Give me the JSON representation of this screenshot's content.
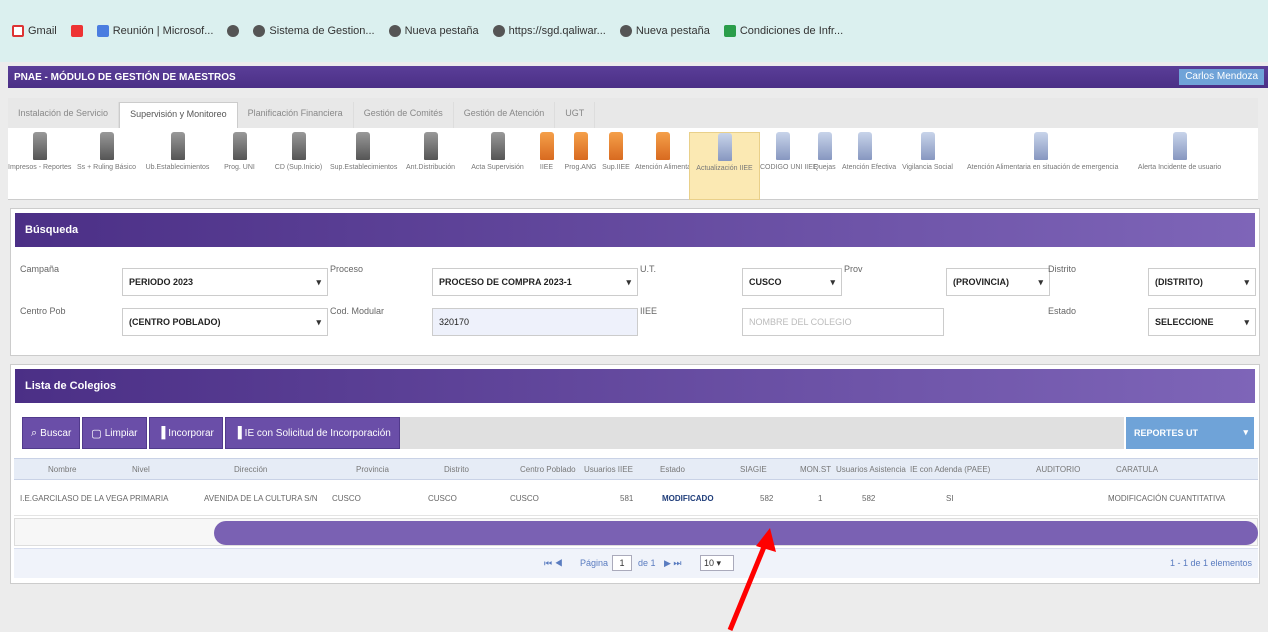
{
  "bookmarks": [
    {
      "label": "Gmail",
      "icon": "gmail-icon"
    },
    {
      "label": "",
      "icon": "red-app-icon"
    },
    {
      "label": "Reunión | Microsof...",
      "icon": "microsoft-icon"
    },
    {
      "label": "",
      "icon": "globe-icon"
    },
    {
      "label": "Sistema de Gestion...",
      "icon": "globe-icon"
    },
    {
      "label": "Nueva pestaña",
      "icon": "globe-icon"
    },
    {
      "label": "https://sgd.qaliwar...",
      "icon": "globe-icon"
    },
    {
      "label": "Nueva pestaña",
      "icon": "globe-icon"
    },
    {
      "label": "Condiciones de Infr...",
      "icon": "sheets-icon"
    }
  ],
  "app": {
    "title": "PNAE - MÓDULO DE GESTIÓN DE MAESTROS",
    "user": "Carlos Mendoza"
  },
  "tabs": [
    "Instalación de Servicio",
    "Supervisión y Monitoreo",
    "Planificación Financiera",
    "Gestión de Comités",
    "Gestión de Atención",
    "UGT"
  ],
  "active_tab": 1,
  "tools": [
    {
      "label": "Impresos - Reportes",
      "color": "gray"
    },
    {
      "label": "Ss + Ruling Básico",
      "color": "gray"
    },
    {
      "label": "Ub.Establecimientos",
      "color": "gray"
    },
    {
      "label": "Prog. UNI",
      "color": "gray"
    },
    {
      "label": "CD (Sup.Inicio)",
      "color": "gray"
    },
    {
      "label": "Sup.Establecimientos",
      "color": "gray"
    },
    {
      "label": "Ant.Distribución",
      "color": "gray"
    },
    {
      "label": "Acta Supervisión",
      "color": "gray"
    },
    {
      "label": "IIEE",
      "color": "orange"
    },
    {
      "label": "Prog.ANG",
      "color": "orange"
    },
    {
      "label": "Sup.IIEE",
      "color": "orange"
    },
    {
      "label": "Atención Alimentaria",
      "color": "orange"
    },
    {
      "label": "Actualización IIEE",
      "color": "blue"
    },
    {
      "label": "CODIGO UNI IIEE",
      "color": "blue"
    },
    {
      "label": "Quejas",
      "color": "blue"
    },
    {
      "label": "Atención Efectiva",
      "color": "blue"
    },
    {
      "label": "Vigilancia Social",
      "color": "blue"
    },
    {
      "label": "Atención Alimentaria en situación de emergencia",
      "color": "blue"
    },
    {
      "label": "Alerta Incidente de usuario",
      "color": "blue"
    }
  ],
  "selected_tool": 12,
  "search": {
    "title": "Búsqueda",
    "campana_label": "Campaña",
    "campana_value": "PERIODO 2023",
    "proceso_label": "Proceso",
    "proceso_value": "PROCESO DE COMPRA 2023-1",
    "ut_label": "U.T.",
    "ut_value": "CUSCO",
    "prov_label": "Prov",
    "prov_value": "(PROVINCIA)",
    "distrito_label": "Distrito",
    "distrito_value": "(DISTRITO)",
    "centro_label": "Centro Pob",
    "centro_value": "(CENTRO POBLADO)",
    "modular_label": "Cod. Modular",
    "modular_value": "320170",
    "iiee_label": "IIEE",
    "iiee_placeholder": "NOMBRE DEL COLEGIO",
    "estado_label": "Estado",
    "estado_value": "SELECCIONE"
  },
  "list": {
    "title": "Lista de Colegios",
    "buttons": [
      {
        "label": "Buscar",
        "icon": "search-icon"
      },
      {
        "label": "Limpiar",
        "icon": "clear-icon"
      },
      {
        "label": "Incorporar",
        "icon": "document-icon"
      },
      {
        "label": "IE con Solicitud de Incorporación",
        "icon": "document-icon"
      }
    ],
    "report_label": "REPORTES UT",
    "columns": [
      "Nombre",
      "Nivel",
      "Dirección",
      "Provincia",
      "Distrito",
      "Centro Poblado",
      "Usuarios IIEE",
      "Estado",
      "SIAGIE",
      "MON.ST",
      "Usuarios Asistencia",
      "IE con Adenda (PAEE)",
      "AUDITORIO",
      "CARATULA"
    ],
    "rows": [
      [
        "I.E.GARCILASO DE LA VEGA PRIMARIA",
        "",
        "AVENIDA DE LA CULTURA S/N",
        "CUSCO",
        "CUSCO",
        "CUSCO",
        "581",
        "MODIFICADO",
        "582",
        "1",
        "582",
        "SI",
        "",
        "MODIFICACIÓN CUANTITATIVA"
      ]
    ]
  },
  "pager": {
    "page_label": "Página",
    "page_value": "1",
    "of_label": "de 1",
    "page_size": "10",
    "summary": "1 - 1 de 1 elementos"
  },
  "colors": {
    "header_purple": "#4b2f86",
    "accent_blue": "#6fa3d8",
    "annotation_arrow": "#ff0000"
  }
}
